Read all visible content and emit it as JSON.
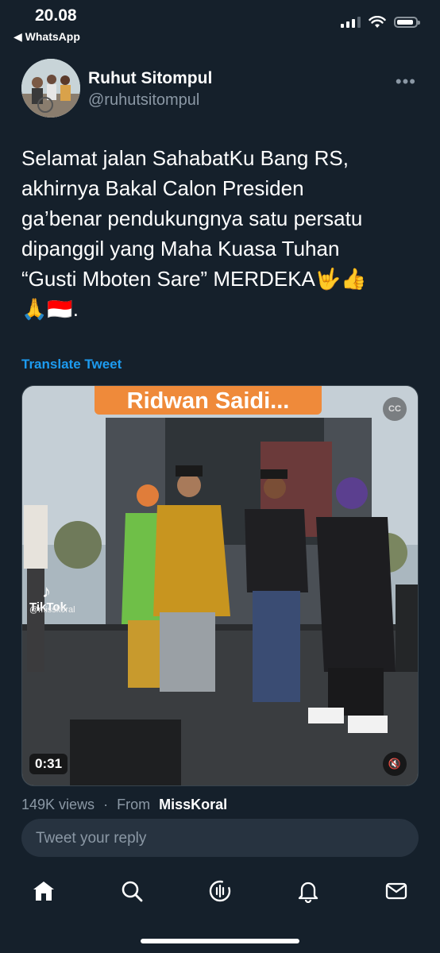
{
  "status_bar": {
    "time": "20.08",
    "back_app": "◀ WhatsApp"
  },
  "tweet": {
    "author_name": "Ruhut Sitompul",
    "author_handle": "@ruhutsitompul",
    "text": "Selamat jalan SahabatKu Bang RS,\nakhirnya Bakal Calon Presiden\nga’benar pendukungnya satu persatu\ndipanggil yang Maha Kuasa Tuhan\n“Gusti Mboten Sare” MERDEKA🤟👍\n🙏🇮🇩.",
    "translate_label": "Translate Tweet"
  },
  "media": {
    "caption_text": "Ridwan Saidi...",
    "cc_label": "CC",
    "tiktok_label": "TikTok",
    "tiktok_user": "@missk0ral",
    "duration": "0:31"
  },
  "stats": {
    "views": "149K views",
    "separator": "·",
    "from_label": "From",
    "from_user": "MissKoral"
  },
  "reply": {
    "placeholder": "Tweet your reply"
  },
  "tabs": [
    {
      "name": "home-icon"
    },
    {
      "name": "search-icon"
    },
    {
      "name": "spaces-icon"
    },
    {
      "name": "notifications-icon"
    },
    {
      "name": "messages-icon"
    }
  ],
  "colors": {
    "background": "#15202b",
    "accent": "#1d9bf0",
    "secondary_text": "#8b98a5",
    "caption_orange": "#ef8a3a"
  }
}
